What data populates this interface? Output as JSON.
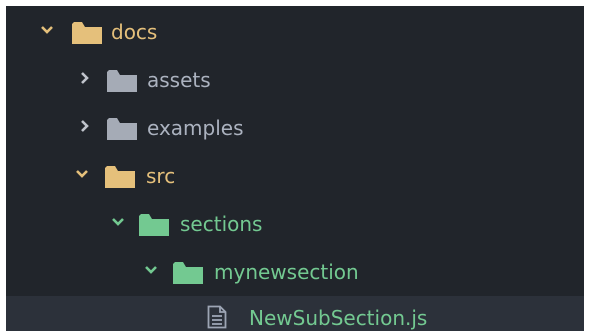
{
  "tree": {
    "docs": {
      "label": "docs",
      "color": "#e5c07b",
      "expanded": true,
      "icon": "folder-icon"
    },
    "assets": {
      "label": "assets",
      "color": "#abb2bf",
      "expanded": false,
      "icon": "folder-icon"
    },
    "examples": {
      "label": "examples",
      "color": "#abb2bf",
      "expanded": false,
      "icon": "folder-icon"
    },
    "src": {
      "label": "src",
      "color": "#e5c07b",
      "expanded": true,
      "icon": "folder-icon"
    },
    "sections": {
      "label": "sections",
      "color": "#73c991",
      "expanded": true,
      "icon": "folder-icon"
    },
    "mynewsection": {
      "label": "mynewsection",
      "color": "#73c991",
      "expanded": true,
      "icon": "folder-icon"
    },
    "newsubsection": {
      "label": "NewSubSection.js",
      "color": "#73c991",
      "selected": true,
      "icon": "file-text-icon"
    }
  },
  "colors": {
    "background": "#21252b",
    "selected_row": "#2c313a",
    "folder_modified": "#e5c07b",
    "folder_default": "#a5abb6",
    "git_added": "#73c991"
  }
}
